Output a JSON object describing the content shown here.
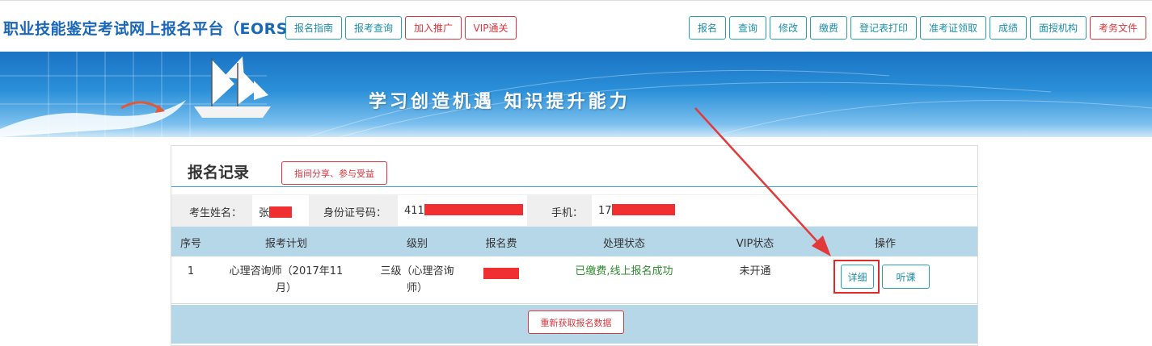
{
  "header": {
    "title": "职业技能鉴定考试网上报名平台（EORS）",
    "left_buttons": [
      "报名指南",
      "报考查询",
      "加入推广",
      "VIP通关"
    ],
    "right_buttons": [
      "报名",
      "查询",
      "修改",
      "缴费",
      "登记表打印",
      "准考证领取",
      "成绩",
      "面授机构",
      "考务文件"
    ]
  },
  "banner": {
    "slogan": "学习创造机遇  知识提升能力"
  },
  "record": {
    "title": "报名记录",
    "share_button": "指间分享、参与受益",
    "student": {
      "name_label": "考生姓名：",
      "name_value": "张",
      "id_label": "身份证号码：",
      "id_value": "411",
      "phone_label": "手机：",
      "phone_value": "17"
    },
    "columns": [
      "序号",
      "报考计划",
      "级别",
      "报名费",
      "处理状态",
      "VIP状态",
      "操作"
    ],
    "rows": [
      {
        "index": "1",
        "plan": "心理咨询师（2017年11月）",
        "level": "三级（心理咨询师）",
        "fee": "",
        "status": "已缴费,线上报名成功",
        "vip": "未开通",
        "detail_button": "详细",
        "listen_button": "听课"
      }
    ],
    "refresh_button": "重新获取报名数据"
  },
  "colors": {
    "accent": "#1d8fa8",
    "danger": "#d9363e",
    "header_blue": "#1a67b8",
    "table_head": "#b5d7e8",
    "success": "#2e8b2e",
    "redaction": "#f03030"
  }
}
